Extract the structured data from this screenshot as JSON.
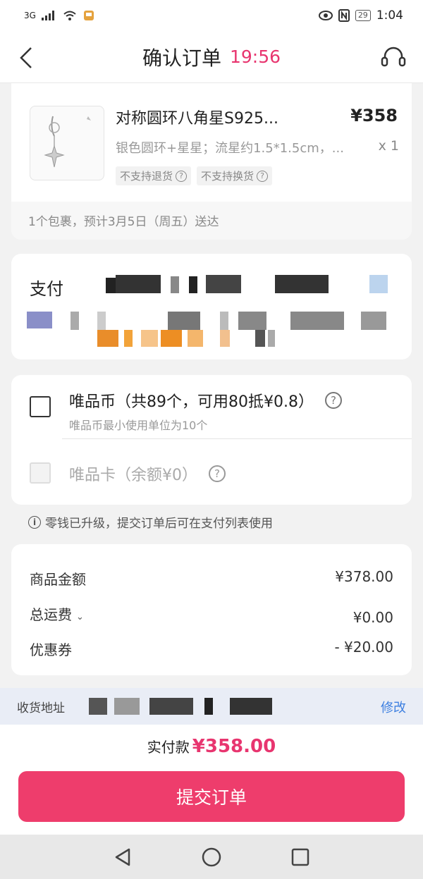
{
  "status": {
    "network": "3G",
    "time": "1:04",
    "battery": "29"
  },
  "header": {
    "title": "确认订单",
    "countdown": "19:56"
  },
  "product": {
    "name": "对称圆环八角星S925...",
    "price": "¥358",
    "spec": "银色圆环+星星；流星约1.5*1.5cm，...",
    "qty": "x 1",
    "tags": [
      "不支持退货",
      "不支持换货"
    ],
    "delivery": "1个包裹，预计3月5日（周五）送达"
  },
  "payment": {
    "label": "支付"
  },
  "coins": {
    "title": "唯品币（共89个，可用80抵¥0.8）",
    "subtitle": "唯品币最小使用单位为10个",
    "card_title": "唯品卡（余额¥0）"
  },
  "notice": "零钱已升级，提交订单后可在支付列表使用",
  "summary": {
    "rows": [
      {
        "label": "商品金额",
        "value": "¥378.00"
      },
      {
        "label": "总运费",
        "value": "¥0.00"
      },
      {
        "label": "优惠券",
        "value": "- ¥20.00"
      }
    ]
  },
  "address": {
    "label": "收货地址",
    "edit": "修改"
  },
  "footer": {
    "total_label": "实付款",
    "total_amount": "¥358.00",
    "submit": "提交订单"
  },
  "colors": {
    "accent": "#ee3d6c",
    "price_pink": "#e8356f",
    "link_blue": "#3d7fe0"
  },
  "icons": [
    "back-arrow-icon",
    "customer-service-icon",
    "help-icon",
    "info-icon",
    "nav-back-icon",
    "nav-home-icon",
    "nav-recent-icon"
  ]
}
